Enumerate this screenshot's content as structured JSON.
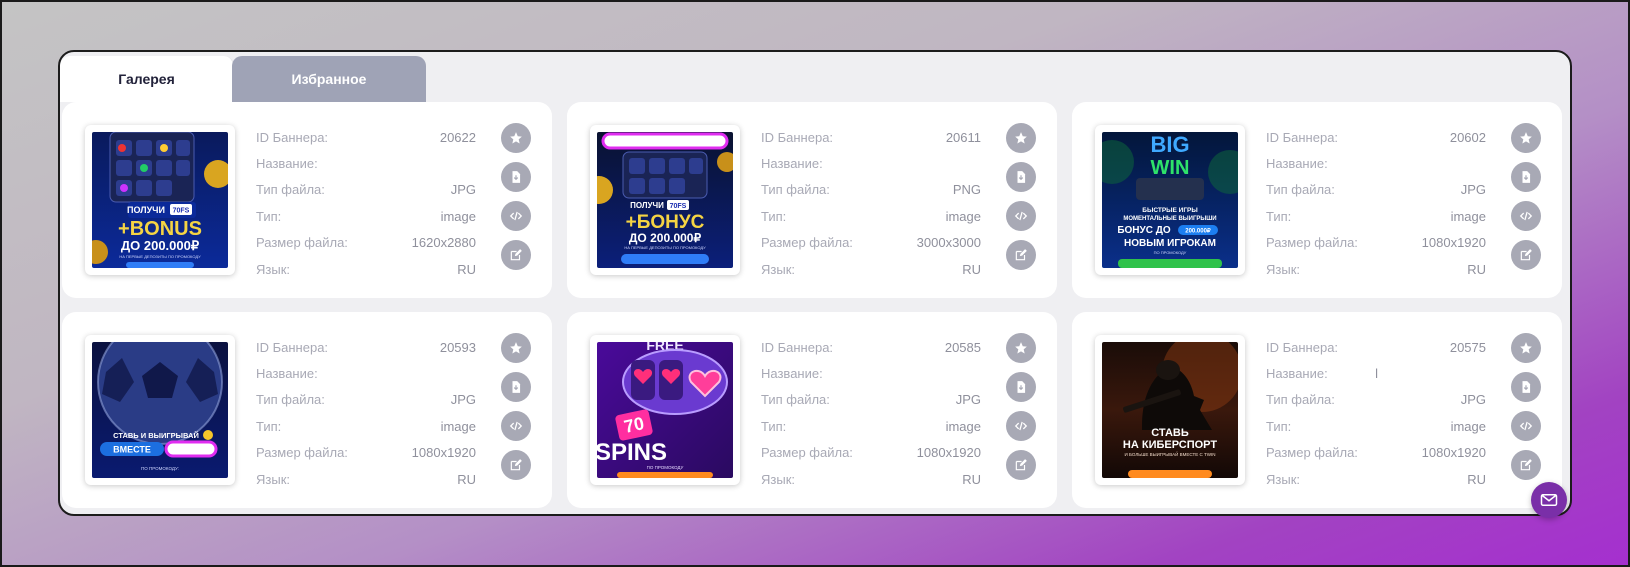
{
  "tabs": [
    {
      "label": "Галерея",
      "active": true
    },
    {
      "label": "Избранное",
      "active": false
    }
  ],
  "labels": {
    "id": "ID Баннера:",
    "name": "Название:",
    "file_type": "Тип файла:",
    "type": "Тип:",
    "size": "Размер файла:",
    "lang": "Язык:"
  },
  "banners": [
    {
      "id": "20622",
      "name": "",
      "file_type": "JPG",
      "type": "image",
      "size": "1620x2880",
      "lang": "RU",
      "art": {
        "l1": "ПОЛУЧИ",
        "badge": "70FS",
        "l2": "+BONUS",
        "l3": "ДО 200.000₽",
        "l4": "НА ПЕРВЫЕ ДЕПОЗИТЫ ПО ПРОМОКОДУ"
      }
    },
    {
      "id": "20611",
      "name": "",
      "file_type": "PNG",
      "type": "image",
      "size": "3000x3000",
      "lang": "RU",
      "art": {
        "l1": "ПОЛУЧИ",
        "badge": "70FS",
        "l2": "+БОНУС",
        "l3": "ДО 200.000₽",
        "l4": "НА ПЕРВЫЕ ДЕПОЗИТЫ ПО ПРОМОКОДУ"
      }
    },
    {
      "id": "20602",
      "name": "",
      "file_type": "JPG",
      "type": "image",
      "size": "1080x1920",
      "lang": "RU",
      "art": {
        "l1": "BIG",
        "l2": "WIN",
        "l3": "БЫСТРЫЕ ИГРЫ",
        "l4": "МОМЕНТАЛЬНЫЕ ВЫИГРЫШИ",
        "l5": "БОНУС ДО",
        "badge": "200.000₽",
        "l6": "НОВЫМ ИГРОКАМ",
        "l7": "ПО ПРОМОКОДУ"
      }
    },
    {
      "id": "20593",
      "name": "",
      "file_type": "JPG",
      "type": "image",
      "size": "1080x1920",
      "lang": "RU",
      "art": {
        "l1": "СТАВЬ И ВЫИГРЫВАЙ",
        "l2": "ВМЕСТЕ",
        "l3": "ПО ПРОМОКОДУ:"
      }
    },
    {
      "id": "20585",
      "name": "",
      "file_type": "JPG",
      "type": "image",
      "size": "1080x1920",
      "lang": "RU",
      "art": {
        "l1": "FREE",
        "badge": "70",
        "l2": "SPINS",
        "l3": "ПО ПРОМОКОДУ"
      }
    },
    {
      "id": "20575",
      "name": "l",
      "file_type": "JPG",
      "type": "image",
      "size": "1080x1920",
      "lang": "RU",
      "art": {
        "l1": "СТАВЬ",
        "l2": "НА КИБЕРСПОРТ",
        "l3": "И БОЛЬШЕ ВЫИГРЫВАЙ ВМЕСТЕ С TWIN"
      }
    }
  ],
  "colors": {
    "accent": "#7a2fa8",
    "action_bg": "#a8a9b5",
    "tab_inactive": "#9fa3b6"
  },
  "icons": {
    "favorite": "star-icon",
    "download": "download-file-icon",
    "embed": "code-icon",
    "edit": "edit-icon",
    "contact": "mail-icon"
  }
}
